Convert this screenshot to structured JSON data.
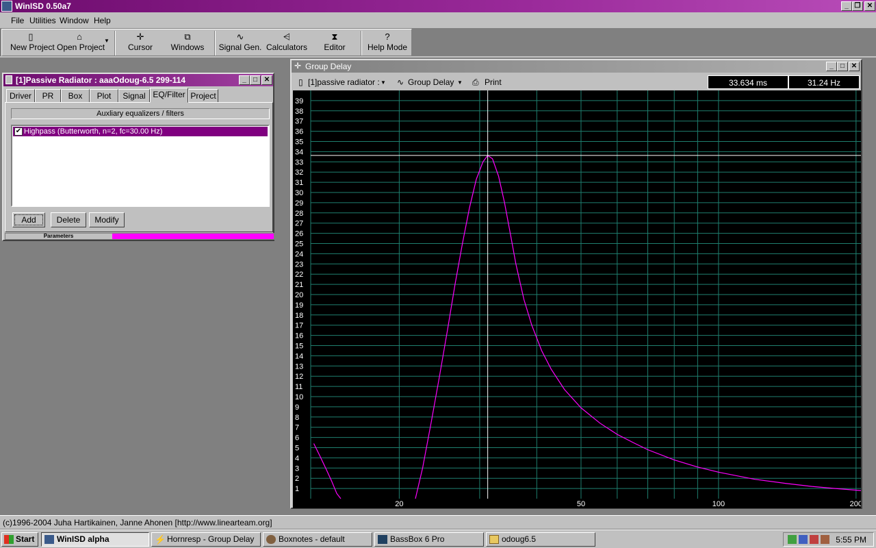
{
  "app": {
    "title": "WinISD 0.50a7"
  },
  "menu": [
    "File",
    "Utilities",
    "Window",
    "Help"
  ],
  "toolbar": {
    "new_project": "New Project",
    "open_project": "Open Project",
    "cursor": "Cursor",
    "windows": "Windows",
    "signal_gen": "Signal Gen.",
    "calculators": "Calculators",
    "editor": "Editor",
    "help_mode": "Help Mode"
  },
  "project_window": {
    "title": "[1]Passive Radiator : aaaOdoug-6.5 299-114",
    "tabs": [
      "Driver",
      "PR",
      "Box",
      "Plot",
      "Signal",
      "EQ/Filter",
      "Project"
    ],
    "active_tab": "EQ/Filter",
    "group_header": "Auxliary equalizers / filters",
    "filters": [
      {
        "checked": true,
        "label": "Highpass (Butterworth, n=2, fc=30.00 Hz)"
      }
    ],
    "buttons": {
      "add": "Add",
      "delete": "Delete",
      "modify": "Modify"
    },
    "status_label": "Parameters"
  },
  "graph_window": {
    "title": "Group Delay",
    "project_select": "[1]passive radiator :",
    "mode_select": "Group Delay",
    "print": "Print",
    "readout_time": "33.634 ms",
    "readout_freq": "31.24 Hz"
  },
  "chart_data": {
    "type": "line",
    "title": "Group Delay",
    "xlabel": "",
    "ylabel": "",
    "xscale": "log",
    "xlim": [
      12.8,
      205
    ],
    "ylim": [
      0,
      40
    ],
    "x_tick_labels": [
      "20",
      "50",
      "100",
      "200"
    ],
    "y_tick_labels": [
      "1",
      "2",
      "3",
      "4",
      "5",
      "6",
      "7",
      "8",
      "9",
      "10",
      "11",
      "12",
      "13",
      "14",
      "15",
      "16",
      "17",
      "18",
      "19",
      "20",
      "21",
      "22",
      "23",
      "24",
      "25",
      "26",
      "27",
      "28",
      "29",
      "30",
      "31",
      "32",
      "33",
      "34",
      "35",
      "36",
      "37",
      "38",
      "39"
    ],
    "cursor": {
      "x": 31.24,
      "y": 33.634
    },
    "grid": true,
    "series": [
      {
        "color": "#ff00ff",
        "segments": [
          [
            [
              13.0,
              5.4
            ],
            [
              13.4,
              4.2
            ],
            [
              13.8,
              3.0
            ],
            [
              14.2,
              1.8
            ],
            [
              14.6,
              0.5
            ],
            [
              14.9,
              0
            ]
          ],
          [
            [
              21.7,
              0
            ],
            [
              22.5,
              3.0
            ],
            [
              23.5,
              7.5
            ],
            [
              24.5,
              12.0
            ],
            [
              25.5,
              16.5
            ],
            [
              26.5,
              21.0
            ],
            [
              27.5,
              25.0
            ],
            [
              28.5,
              28.5
            ],
            [
              29.5,
              31.3
            ],
            [
              30.5,
              33.0
            ],
            [
              31.24,
              33.63
            ],
            [
              32.0,
              33.3
            ],
            [
              33.0,
              31.6
            ],
            [
              34.0,
              29.0
            ],
            [
              35.0,
              26.0
            ],
            [
              36.0,
              23.0
            ],
            [
              37.5,
              19.5
            ],
            [
              39.0,
              17.0
            ],
            [
              41.0,
              14.5
            ],
            [
              43.0,
              12.7
            ],
            [
              46.0,
              10.7
            ],
            [
              50.0,
              8.9
            ],
            [
              55.0,
              7.4
            ],
            [
              60.0,
              6.3
            ],
            [
              65.0,
              5.5
            ],
            [
              70.0,
              4.8
            ],
            [
              80.0,
              3.8
            ],
            [
              90.0,
              3.1
            ],
            [
              100.0,
              2.6
            ],
            [
              120.0,
              1.9
            ],
            [
              140.0,
              1.5
            ],
            [
              160.0,
              1.2
            ],
            [
              180.0,
              1.0
            ],
            [
              205.0,
              0.8
            ]
          ]
        ]
      }
    ]
  },
  "statusbar": {
    "text": "(c)1996-2004 Juha Hartikainen, Janne Ahonen [http://www.linearteam.org]"
  },
  "taskbar": {
    "start": "Start",
    "tasks": [
      "WinISD alpha",
      "Hornresp - Group Delay",
      "Boxnotes - default",
      "BassBox 6 Pro",
      "odoug6.5"
    ],
    "clock": "5:55 PM"
  }
}
